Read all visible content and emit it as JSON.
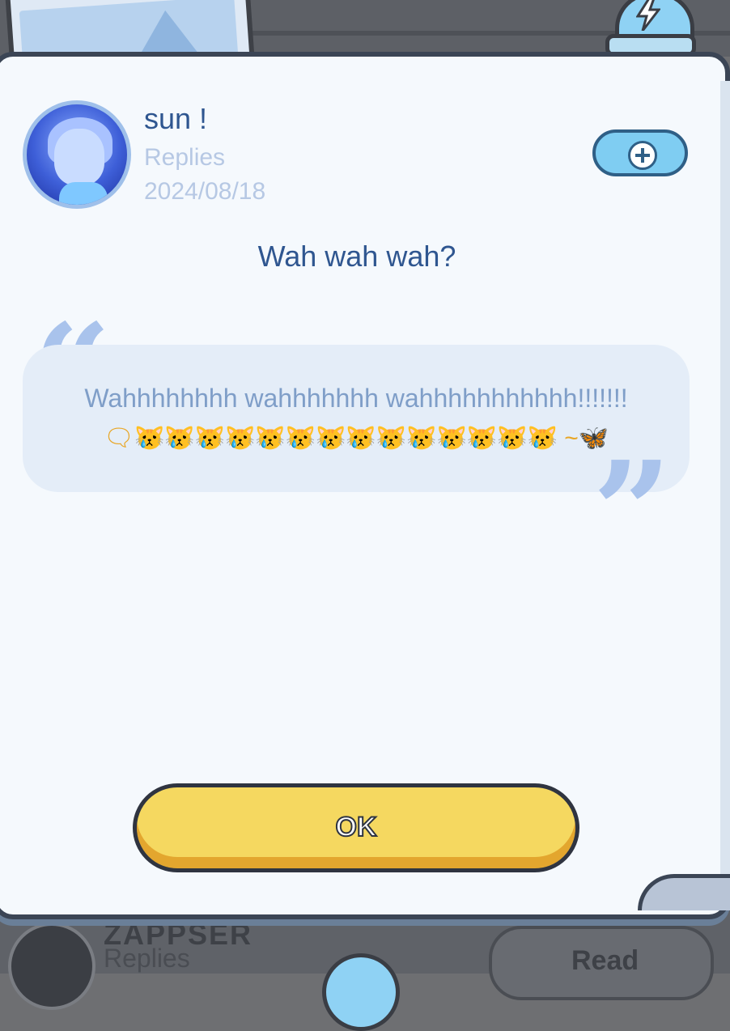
{
  "background": {
    "bottom_name": "ZAPPSER",
    "bottom_replies": "Replies",
    "read_label": "Read"
  },
  "post": {
    "username": "sun !",
    "type_label": "Replies",
    "date": "2024/08/18",
    "subject": "Wah wah wah?",
    "message_line1": "Wahhhhhhhh wahhhhhhh wahhhhhhhhhhh!!!!!!!",
    "message_line2": "🗨😿😿😿😿😿😿😿😿😿😿😿😿😿😿 ~🦋"
  },
  "buttons": {
    "ok_label": "OK"
  },
  "icons": {
    "add": "plus-icon",
    "alarm": "lightning-icon",
    "quote_open": "quote-open-icon",
    "quote_close": "quote-close-icon"
  },
  "colors": {
    "accent_blue": "#2f5690",
    "ok_yellow": "#f5d860",
    "quote_bg": "#e4edf8"
  }
}
